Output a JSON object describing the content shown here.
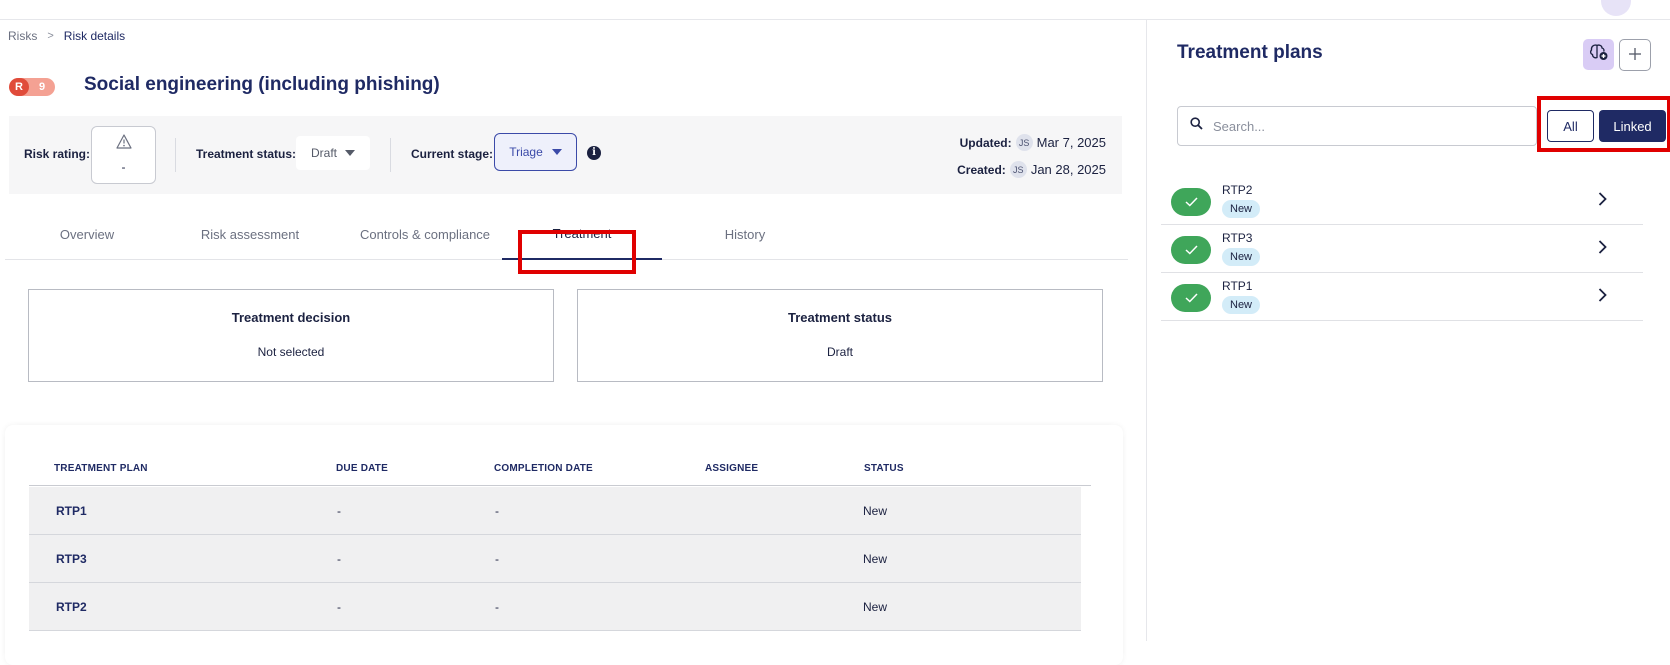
{
  "breadcrumb": {
    "root": "Risks",
    "separator": ">",
    "current": "Risk details"
  },
  "risk": {
    "badge_letter": "R",
    "badge_score": "9",
    "title": "Social engineering (including phishing)"
  },
  "info_bar": {
    "risk_rating_label": "Risk rating:",
    "risk_rating_value": "-",
    "treatment_status_label": "Treatment status:",
    "treatment_status_value": "Draft",
    "current_stage_label": "Current stage:",
    "current_stage_value": "Triage",
    "updated_label": "Updated:",
    "updated_initials": "JS",
    "updated_date": "Mar 7, 2025",
    "created_label": "Created:",
    "created_initials": "JS",
    "created_date": "Jan 28, 2025"
  },
  "tabs": [
    {
      "label": "Overview"
    },
    {
      "label": "Risk assessment"
    },
    {
      "label": "Controls & compliance"
    },
    {
      "label": "Treatment"
    },
    {
      "label": "History"
    }
  ],
  "active_tab": "Treatment",
  "cards": {
    "decision": {
      "heading": "Treatment decision",
      "value": "Not selected"
    },
    "status": {
      "heading": "Treatment status",
      "value": "Draft"
    }
  },
  "table": {
    "headers": [
      "TREATMENT PLAN",
      "DUE DATE",
      "COMPLETION DATE",
      "ASSIGNEE",
      "STATUS"
    ],
    "rows": [
      {
        "plan": "RTP1",
        "due": "-",
        "completion": "-",
        "assignee": "",
        "status": "New"
      },
      {
        "plan": "RTP3",
        "due": "-",
        "completion": "-",
        "assignee": "",
        "status": "New"
      },
      {
        "plan": "RTP2",
        "due": "-",
        "completion": "-",
        "assignee": "",
        "status": "New"
      }
    ]
  },
  "panel": {
    "title": "Treatment plans",
    "search_placeholder": "Search...",
    "filter_all": "All",
    "filter_linked": "Linked",
    "items": [
      {
        "name": "RTP2",
        "badge": "New"
      },
      {
        "name": "RTP3",
        "badge": "New"
      },
      {
        "name": "RTP1",
        "badge": "New"
      }
    ]
  },
  "icons": {
    "breadcrumb_separator": "chevron-right-icon",
    "risk_rating": "warning-triangle-icon",
    "dropdown": "caret-down-icon",
    "info": "info-icon",
    "ai": "ai-brain-icon",
    "add": "plus-icon",
    "search": "search-icon",
    "check": "check-icon",
    "chevron": "chevron-right-icon"
  },
  "colors": {
    "primary": "#1f2a64",
    "highlight": "#e00000",
    "risk_badge": "#e04b3a",
    "check_green": "#3fa65a",
    "new_badge": "#d3ecf8"
  }
}
